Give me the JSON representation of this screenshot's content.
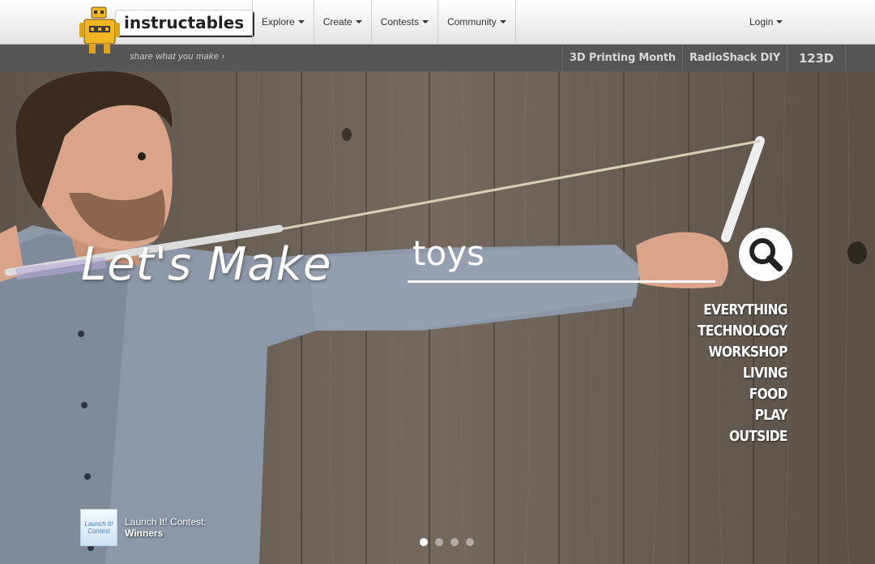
{
  "header": {
    "logo_text": "instructables",
    "nav": [
      "Explore",
      "Create",
      "Contests",
      "Community"
    ],
    "login_label": "Login"
  },
  "subbar": {
    "tagline": "share what you make  ›",
    "links": [
      "3D Printing Month",
      "RadioShack DIY",
      "123D"
    ]
  },
  "hero": {
    "headline": "Let's Make",
    "search_value": "toys",
    "categories": [
      "EVERYTHING",
      "TECHNOLOGY",
      "WORKSHOP",
      "LIVING",
      "FOOD",
      "PLAY",
      "OUTSIDE"
    ],
    "promo": {
      "thumb_text": "Launch It! Contest",
      "line1": "Launch It! Contest:",
      "line2": "Winners"
    },
    "carousel": {
      "count": 4,
      "active": 0
    }
  },
  "colors": {
    "topbar": "#f0f0f0",
    "subbar": "#555555",
    "wood": "#6b5f55",
    "shirt": "#8f9aab"
  },
  "icons": [
    "robot-logo-icon",
    "caret-down-icon",
    "search-icon"
  ]
}
